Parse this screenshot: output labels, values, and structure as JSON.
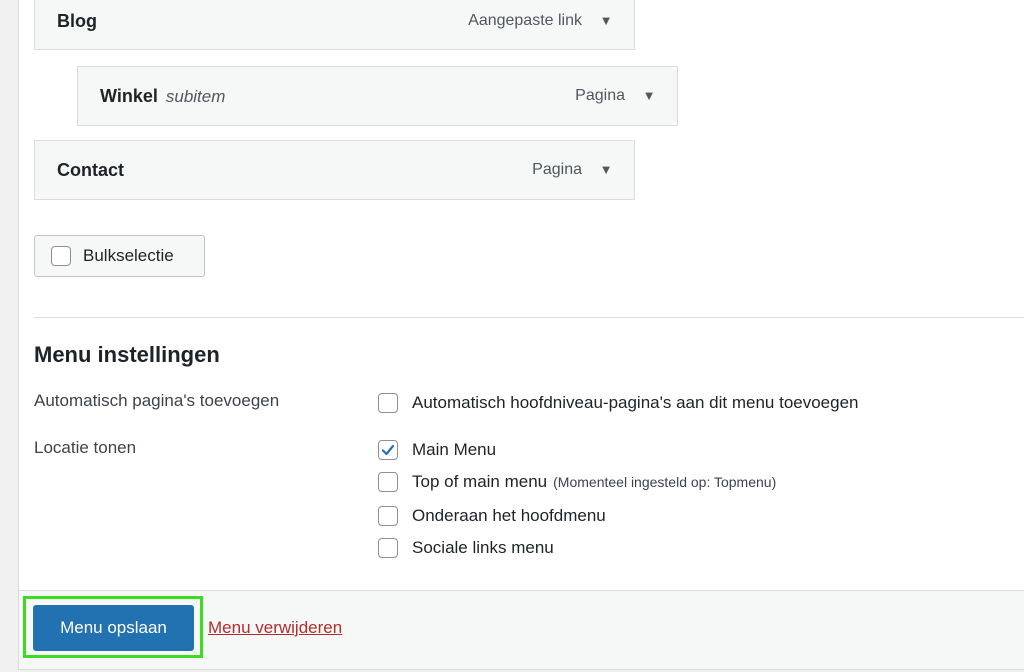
{
  "menu_items": [
    {
      "title": "Blog",
      "subtitle": "",
      "type": "Aangepaste link"
    },
    {
      "title": "Winkel",
      "subtitle": "subitem",
      "type": "Pagina"
    },
    {
      "title": "Contact",
      "subtitle": "",
      "type": "Pagina"
    }
  ],
  "bulk_select_label": "Bulkselectie",
  "settings": {
    "title": "Menu instellingen",
    "auto_add": {
      "label": "Automatisch pagina's toevoegen",
      "option": "Automatisch hoofdniveau-pagina's aan dit menu toevoegen",
      "checked": false
    },
    "locations": {
      "label": "Locatie tonen",
      "options": [
        {
          "label": "Main Menu",
          "note": "",
          "checked": true
        },
        {
          "label": "Top of main menu",
          "note": "(Momenteel ingesteld op: Topmenu)",
          "checked": false
        },
        {
          "label": "Onderaan het hoofdmenu",
          "note": "",
          "checked": false
        },
        {
          "label": "Sociale links menu",
          "note": "",
          "checked": false
        }
      ]
    }
  },
  "footer": {
    "save_label": "Menu opslaan",
    "delete_label": "Menu verwijderen"
  },
  "colors": {
    "primary": "#2271b1",
    "highlight": "#3ddc1e",
    "delete": "#b32d2e"
  },
  "icons": {
    "dropdown": "chevron-down-icon",
    "checkmark": "checkmark-icon"
  }
}
